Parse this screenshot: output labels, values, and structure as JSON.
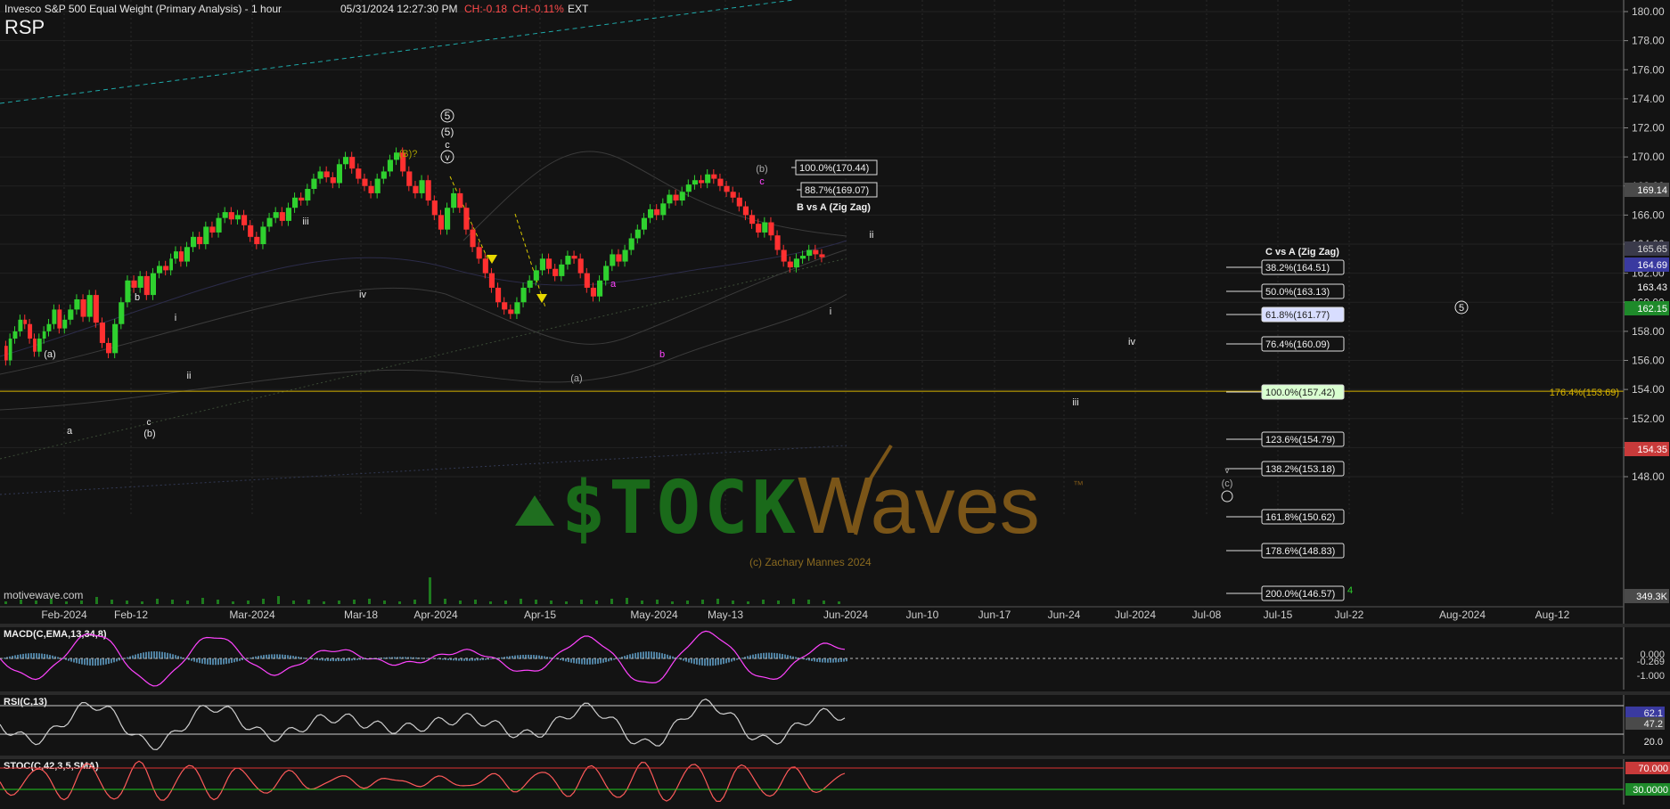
{
  "header": {
    "title": "Invesco S&P 500 Equal Weight (Primary Analysis) - 1 hour",
    "timestamp": "05/31/2024 12:27:30 PM",
    "change1": "CH:-0.18",
    "change2": "CH:-0.11%",
    "session": "EXT",
    "symbol": "RSP"
  },
  "colors": {
    "background": "#131313",
    "grid": "#3a3a3a",
    "up_candle": "#2fd12f",
    "down_candle": "#ff3030",
    "fib_line": "#ffffff",
    "level_line": "#d8b400",
    "macd_line": "#ff44ff",
    "macd_hist": "#6ab0de",
    "rsi_line": "#cfcfcf",
    "stoch_line": "#ff5a5a",
    "watermark_green": "#1f6e1f",
    "watermark_brown": "#7a5518"
  },
  "chart_data": {
    "type": "line",
    "symbol": "RSP",
    "ylim": [
      145,
      181
    ],
    "ytick_labels": [
      "180.00",
      "178.00",
      "176.00",
      "174.00",
      "172.00",
      "170.00",
      "168.00",
      "166.00",
      "164.00",
      "162.00",
      "160.00",
      "158.00",
      "156.00",
      "154.00",
      "152.00",
      "150.00",
      "148.00"
    ],
    "yticks": [
      180,
      178,
      176,
      174,
      172,
      170,
      168,
      166,
      164,
      162,
      160,
      158,
      156,
      154,
      152,
      150,
      148
    ],
    "xtick_labels": [
      "Feb-2024",
      "Feb-12",
      "Mar-2024",
      "Mar-18",
      "Apr-2024",
      "Apr-15",
      "May-2024",
      "May-13",
      "Jun-2024",
      "Jun-10",
      "Jun-17",
      "Jun-24",
      "Jul-2024",
      "Jul-08",
      "Jul-15",
      "Jul-22",
      "Aug-2024",
      "Aug-12"
    ],
    "price_series": {
      "name": "RSP",
      "x_index": [
        0,
        4,
        8,
        13,
        18,
        22,
        27,
        31,
        36,
        40,
        45,
        50,
        55,
        60,
        66,
        72,
        78,
        84,
        90,
        96,
        102,
        108,
        114,
        120,
        126,
        132,
        138,
        144,
        150,
        156,
        160,
        165,
        170,
        176,
        182,
        188,
        194,
        200,
        206,
        212,
        218,
        224,
        230,
        236,
        242,
        248,
        254,
        260,
        266,
        272,
        278,
        284,
        290,
        296,
        302,
        308,
        314,
        320,
        326,
        332,
        338,
        344,
        350,
        356,
        362,
        368,
        374,
        380,
        386,
        392,
        398,
        404,
        410,
        416,
        422,
        428,
        434,
        440,
        446,
        452,
        458,
        464,
        470,
        476,
        482,
        488,
        494,
        500,
        506,
        512,
        518,
        524,
        530,
        536,
        542,
        548,
        554,
        560,
        566,
        572,
        578,
        584,
        590,
        596,
        602,
        608,
        614,
        620,
        626,
        632,
        638,
        644,
        650,
        656,
        662,
        668,
        674,
        680,
        686,
        692,
        698,
        704,
        710,
        716,
        722,
        728,
        734,
        740,
        746,
        752,
        758,
        764,
        770,
        776,
        782,
        788,
        794
      ],
      "values": [
        157.0,
        156.0,
        157.5,
        158.0,
        158.8,
        158.5,
        157.5,
        156.6,
        157.5,
        158.0,
        158.5,
        159.5,
        158.2,
        158.8,
        159.5,
        160.2,
        159.0,
        160.5,
        158.6,
        157.2,
        156.5,
        158.5,
        160.0,
        161.5,
        161.0,
        161.8,
        160.5,
        162.0,
        162.5,
        162.2,
        163.0,
        163.5,
        162.8,
        163.8,
        164.5,
        164.0,
        165.2,
        164.8,
        165.8,
        166.2,
        165.7,
        166.0,
        165.3,
        164.5,
        164.0,
        165.2,
        165.8,
        166.2,
        165.6,
        166.5,
        167.2,
        167.0,
        167.8,
        168.5,
        169.0,
        168.6,
        168.2,
        169.5,
        170.0,
        169.2,
        168.5,
        168.0,
        167.5,
        168.5,
        169.0,
        169.8,
        170.3,
        169.0,
        168.0,
        167.5,
        168.4,
        167.0,
        166.0,
        165.0,
        166.5,
        167.5,
        166.5,
        165.0,
        163.8,
        163.0,
        162.0,
        161.0,
        160.0,
        159.5,
        159.2,
        160.0,
        161.0,
        161.5,
        162.2,
        163.0,
        162.3,
        161.8,
        162.6,
        163.2,
        163.0,
        162.0,
        161.0,
        160.4,
        161.5,
        162.5,
        163.3,
        162.8,
        163.6,
        164.4,
        165.0,
        165.8,
        166.4,
        166.0,
        166.8,
        167.4,
        167.0,
        167.6,
        168.1,
        168.4,
        168.2,
        168.8,
        168.5,
        168.0,
        167.6,
        167.2,
        166.6,
        166.0,
        165.4,
        164.8,
        165.5,
        164.6,
        163.6,
        162.8,
        162.4,
        163.0,
        163.2,
        163.6,
        163.3,
        163.1
      ]
    },
    "wave_labels": [
      "5",
      "(5)",
      "c",
      "v",
      "(B)?",
      "iii",
      "iv",
      "ii",
      "i",
      "b",
      "(a)",
      "a",
      "c",
      "(b)",
      "(b)",
      "c",
      "a",
      "b",
      "(a)",
      "i",
      "ii",
      "iv",
      "iii",
      "(c)",
      "v",
      "4",
      "5"
    ],
    "fib_labels": {
      "b_title": "B vs A (Zig Zag)",
      "b_levels": [
        "100.0%(170.44)",
        "88.7%(169.07)"
      ],
      "c_title": "C vs A (Zig Zag)",
      "c_levels": [
        "38.2%(164.51)",
        "50.0%(163.13)",
        "61.8%(161.77)",
        "76.4%(160.09)",
        "100.0%(157.42)",
        "123.6%(154.79)",
        "138.2%(153.18)",
        "161.8%(150.62)",
        "178.6%(148.83)",
        "200.0%(146.57)"
      ],
      "level_line_label": "176.4%(153.69)"
    },
    "price_badges": [
      "169.14",
      "165.65",
      "164.69",
      "163.43",
      "162.15",
      "154.35",
      "349.3K"
    ],
    "volume_label": "motivewave.com",
    "watermark": {
      "stock": "$TOCK",
      "waves": "Waves",
      "tm": "™",
      "copyright": "(c) Zachary Mannes 2024"
    },
    "indicators": {
      "macd": {
        "name": "MACD(C,EMA,13,34,8)",
        "ticks": [
          "0.000",
          "-0.269",
          "-1.000"
        ]
      },
      "rsi": {
        "name": "RSI(C,13)",
        "ticks": [
          "62.1",
          "47.2",
          "20.0"
        ]
      },
      "stoch": {
        "name": "STOC(C,42,3,5,SMA)",
        "ticks": [
          "70.000",
          "30.0000"
        ]
      }
    }
  }
}
